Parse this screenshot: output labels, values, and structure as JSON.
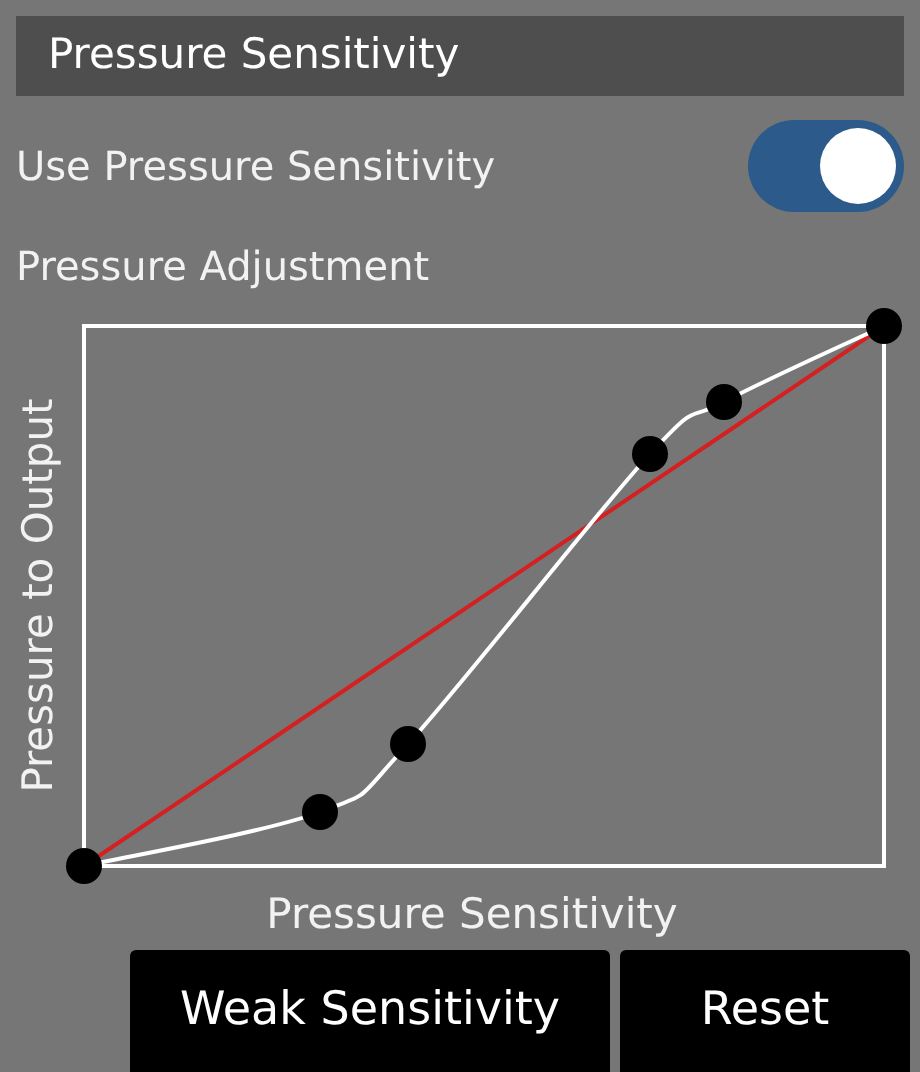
{
  "header": {
    "title": "Pressure Sensitivity"
  },
  "toggle": {
    "label": "Use Pressure Sensitivity",
    "on": true
  },
  "section": {
    "label": "Pressure Adjustment"
  },
  "curve": {
    "ylabel": "Pressure to Output",
    "xlabel": "Pressure Sensitivity"
  },
  "buttons": [
    "Weak Sensitivity",
    "Reset"
  ]
}
